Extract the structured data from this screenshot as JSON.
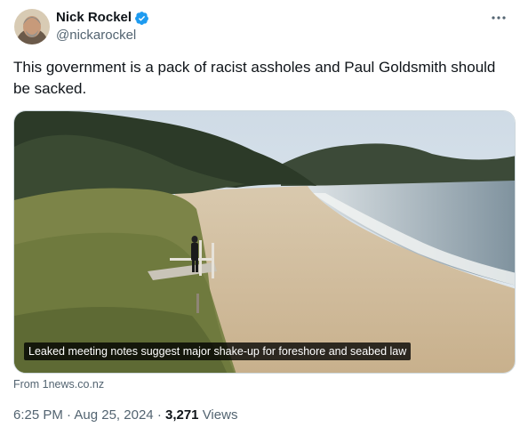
{
  "author": {
    "name": "Nick Rockel",
    "handle": "@nickarockel",
    "verified": true,
    "avatar_icon": "profile-photo"
  },
  "tweet": {
    "text": "This government is a pack of racist assholes and Paul Goldsmith should be sacked."
  },
  "media": {
    "caption": "Leaked meeting notes suggest major shake-up for foreshore and seabed law"
  },
  "card": {
    "source": "From 1news.co.nz"
  },
  "meta": {
    "time": "6:25 PM",
    "date": "Aug 25, 2024",
    "views_count": "3,271",
    "views_label": "Views"
  },
  "colors": {
    "text": "#0f1419",
    "secondary": "#536471",
    "verified": "#1d9bf0"
  }
}
